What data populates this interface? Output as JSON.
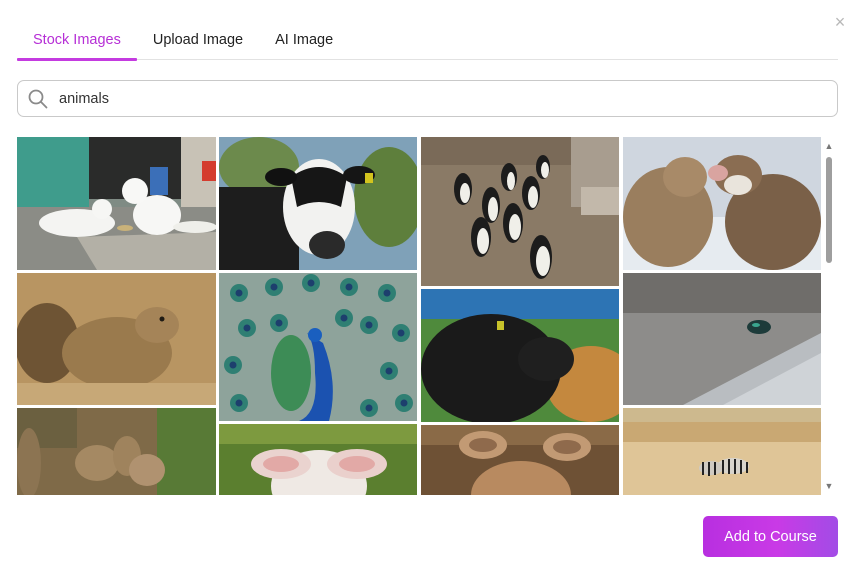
{
  "dialog": {
    "close_label": "×"
  },
  "tabs": [
    {
      "label": "Stock Images",
      "active": true
    },
    {
      "label": "Upload Image",
      "active": false
    },
    {
      "label": "AI Image",
      "active": false
    }
  ],
  "search": {
    "value": "animals",
    "icon": "search-icon"
  },
  "images": [
    {
      "name": "image-white-cats"
    },
    {
      "name": "image-cow"
    },
    {
      "name": "image-penguins"
    },
    {
      "name": "image-husky-dogs"
    },
    {
      "name": "image-prairie-dog"
    },
    {
      "name": "image-peacock"
    },
    {
      "name": "image-black-cow"
    },
    {
      "name": "image-beetle"
    },
    {
      "name": "image-meerkats"
    },
    {
      "name": "image-lamb"
    },
    {
      "name": "image-deer"
    },
    {
      "name": "image-zebras"
    }
  ],
  "scrollbar": {
    "up_glyph": "▲",
    "down_glyph": "▼"
  },
  "footer": {
    "add_button_label": "Add to Course"
  },
  "colors": {
    "accent": "#c43be0",
    "button_gradient_start": "#b82fe0",
    "button_gradient_end": "#a24ce6"
  }
}
